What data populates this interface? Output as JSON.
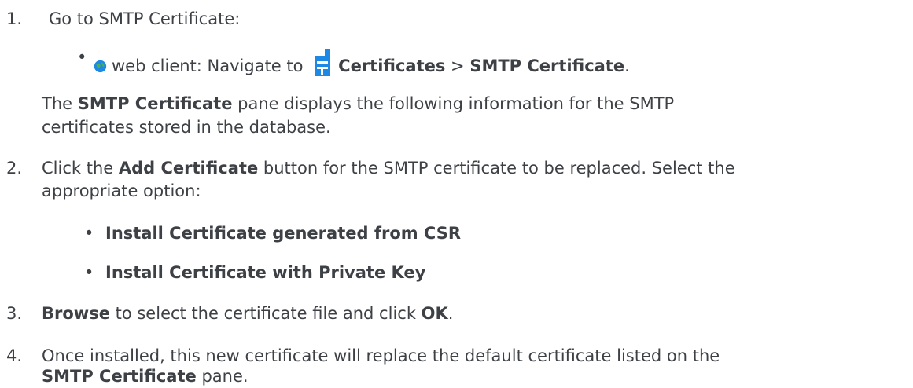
{
  "steps": [
    {
      "num": "1.",
      "text": "Go to SMTP Certificate:"
    },
    {
      "num": "2.",
      "pre": "Click the ",
      "bold": "Add Certificate",
      "post": " button for the SMTP certificate to be replaced. Select the",
      "line2": "appropriate option:"
    },
    {
      "num": "3.",
      "bold1": "Browse",
      "mid": " to select the certificate file and click ",
      "bold2": "OK",
      "end": "."
    },
    {
      "num": "4.",
      "line1": "Once installed, this new certificate will replace the default certificate listed on the",
      "bold": "SMTP Certificate",
      "post": " pane."
    }
  ],
  "nav": {
    "prefix": "web client: Navigate to ",
    "bold1": "Certificates",
    "sep": " > ",
    "bold2": "SMTP Certificate",
    "end": "."
  },
  "pane_info": {
    "bold": "SMTP Certificate",
    "rest1": " pane displays the following information for the SMTP",
    "line2": "certificates stored in the database.",
    "the": "The "
  },
  "options": [
    "Install Certificate generated from CSR",
    "Install Certificate with Private Key"
  ],
  "icons": {
    "web": "globe-icon",
    "cert": "certificate-icon"
  },
  "colors": {
    "text": "#3d4146",
    "icon_blue": "#1e88e5",
    "globe_green": "#4caf50"
  }
}
